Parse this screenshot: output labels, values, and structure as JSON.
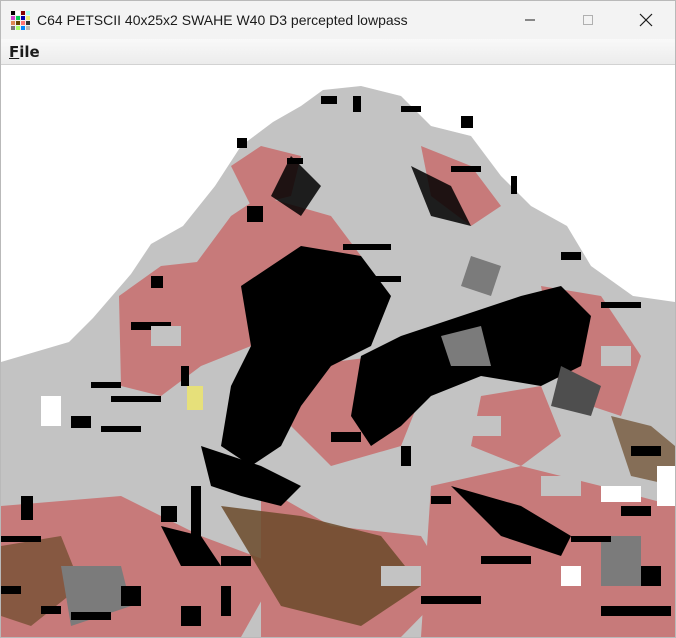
{
  "window": {
    "title": "C64 PETSCII 40x25x2 SWAHE W40 D3 percepted lowpass"
  },
  "window_controls": {
    "minimize_icon": "minimize-icon",
    "maximize_icon": "maximize-icon",
    "close_icon": "close-icon"
  },
  "menu": {
    "file_prefix": "F",
    "file_rest": "ile"
  },
  "canvas": {
    "description_icon": "petscii-image",
    "palette": {
      "white": "#ffffff",
      "light_grey": "#c3c3c3",
      "mid_grey": "#7b7b7b",
      "dark_grey": "#4e4e4e",
      "pink": "#c77a7a",
      "brown": "#6b4a2a",
      "black": "#000000",
      "yellow": "#e6e07a"
    }
  }
}
